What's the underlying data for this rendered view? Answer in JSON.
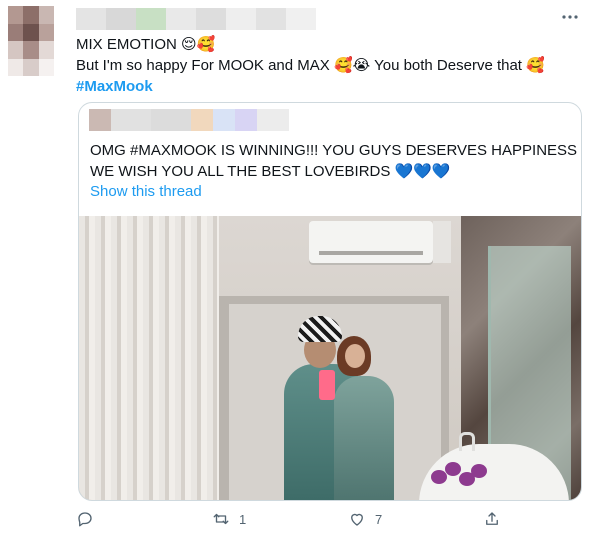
{
  "tweet": {
    "text_line1": "MIX EMOTION",
    "text_line1_emoji": "😌🥰",
    "text_line2_a": "But I'm so happy For MOOK and MAX",
    "text_line2_emoji": "🥰😭",
    "text_line2_b": "You both Deserve that",
    "text_line2_emoji2": "🥰",
    "hashtag": "#MaxMook"
  },
  "quoted": {
    "line1": "OMG #MAXMOOK IS WINNING!!! YOU GUYS DESERVES HAPPINESS",
    "line2": "WE WISH YOU ALL THE BEST LOVEBIRDS",
    "line2_emoji": "💙💙💙",
    "show_thread": "Show this thread"
  },
  "actions": {
    "reply_count": "",
    "retweet_count": "1",
    "like_count": "7"
  },
  "icons": {
    "more": "more-icon",
    "reply": "reply-icon",
    "retweet": "retweet-icon",
    "like": "heart-icon",
    "share": "share-icon"
  },
  "colors": {
    "accent": "#1d9bf0",
    "text": "#0f1419",
    "muted": "#536471",
    "border": "#cfd9de"
  }
}
